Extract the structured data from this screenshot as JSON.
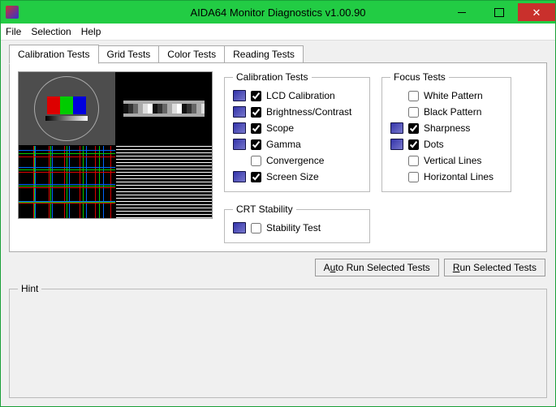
{
  "window": {
    "title": "AIDA64 Monitor Diagnostics v1.00.90"
  },
  "menu": {
    "file": "File",
    "selection": "Selection",
    "help": "Help"
  },
  "tabs": [
    {
      "label": "Calibration Tests",
      "active": true
    },
    {
      "label": "Grid Tests",
      "active": false
    },
    {
      "label": "Color Tests",
      "active": false
    },
    {
      "label": "Reading Tests",
      "active": false
    }
  ],
  "groups": {
    "calibration": {
      "legend": "Calibration Tests",
      "items": [
        {
          "label": "LCD Calibration",
          "checked": true
        },
        {
          "label": "Brightness/Contrast",
          "checked": true
        },
        {
          "label": "Scope",
          "checked": true
        },
        {
          "label": "Gamma",
          "checked": true
        },
        {
          "label": "Convergence",
          "checked": false
        },
        {
          "label": "Screen Size",
          "checked": true
        }
      ]
    },
    "focus": {
      "legend": "Focus Tests",
      "items": [
        {
          "label": "White Pattern",
          "checked": false
        },
        {
          "label": "Black Pattern",
          "checked": false
        },
        {
          "label": "Sharpness",
          "checked": true
        },
        {
          "label": "Dots",
          "checked": true
        },
        {
          "label": "Vertical Lines",
          "checked": false
        },
        {
          "label": "Horizontal Lines",
          "checked": false
        }
      ]
    },
    "crt": {
      "legend": "CRT Stability",
      "items": [
        {
          "label": "Stability Test",
          "checked": false
        }
      ]
    }
  },
  "buttons": {
    "auto": {
      "pre": "A",
      "u": "u",
      "post": "to Run Selected Tests"
    },
    "run": {
      "pre": "",
      "u": "R",
      "post": "un Selected Tests"
    }
  },
  "hint": {
    "legend": "Hint"
  }
}
